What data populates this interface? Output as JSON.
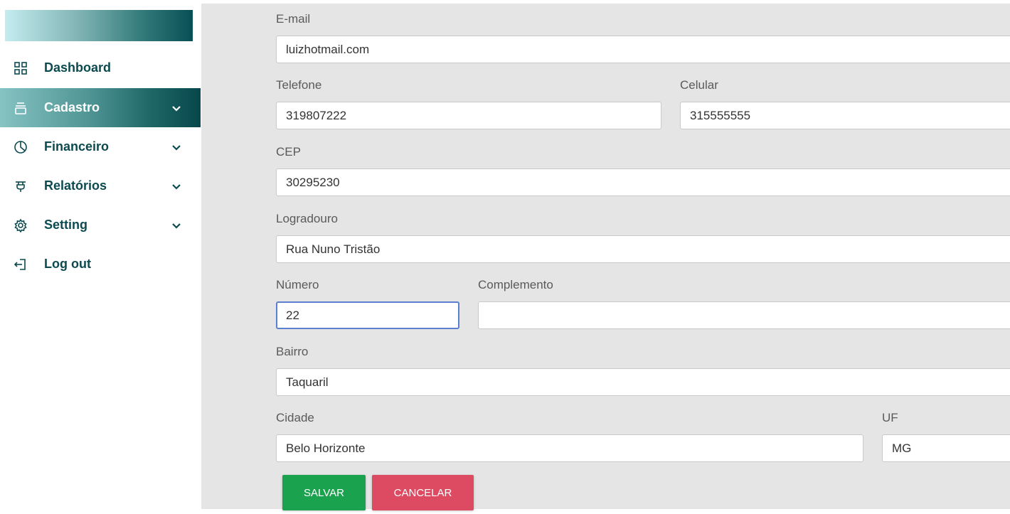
{
  "sidebar": {
    "items": [
      {
        "label": "Dashboard",
        "icon": "grid-icon"
      },
      {
        "label": "Cadastro",
        "icon": "stack-icon",
        "active": true
      },
      {
        "label": "Financeiro",
        "icon": "pie-chart-icon"
      },
      {
        "label": "Relatórios",
        "icon": "plug-icon"
      },
      {
        "label": "Setting",
        "icon": "gear-icon"
      },
      {
        "label": "Log out",
        "icon": "logout-icon"
      }
    ]
  },
  "form": {
    "email": {
      "label": "E-mail",
      "value": "luizhotmail.com"
    },
    "telefone": {
      "label": "Telefone",
      "value": "319807222"
    },
    "celular": {
      "label": "Celular",
      "value": "315555555"
    },
    "cep": {
      "label": "CEP",
      "value": "30295230"
    },
    "logradouro": {
      "label": "Logradouro",
      "value": "Rua Nuno Tristão"
    },
    "numero": {
      "label": "Número",
      "value": "22"
    },
    "complemento": {
      "label": "Complemento",
      "value": ""
    },
    "bairro": {
      "label": "Bairro",
      "value": "Taquaril"
    },
    "cidade": {
      "label": "Cidade",
      "value": "Belo Horizonte"
    },
    "uf": {
      "label": "UF",
      "value": "MG"
    }
  },
  "buttons": {
    "save": "SALVAR",
    "cancel": "CANCELAR"
  },
  "colors": {
    "accent": "#0b4a4f",
    "save": "#1aa24f",
    "cancel": "#dc4b62",
    "focus": "#5b7fd1"
  }
}
